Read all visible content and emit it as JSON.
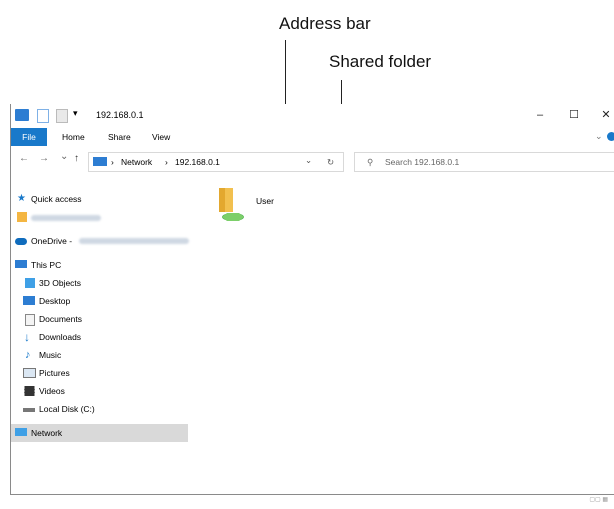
{
  "callouts": {
    "address_bar": "Address bar",
    "shared_folder": "Shared folder"
  },
  "window": {
    "title": "192.168.0.1",
    "minimize": "–",
    "maximize": "☐",
    "close": "✕"
  },
  "ribbon": {
    "tabs": [
      "File",
      "Home",
      "Share",
      "View"
    ]
  },
  "nav": {
    "back": "←",
    "forward": "→",
    "recent": "⌄",
    "up": "↑",
    "breadcrumb": [
      "Network",
      "192.168.0.1"
    ],
    "dropdown": "⌄",
    "refresh": "↻"
  },
  "search": {
    "placeholder": "Search 192.168.0.1"
  },
  "sidebar": {
    "items": [
      {
        "label": "Quick access",
        "icon": "star-icon"
      },
      {
        "label": "",
        "icon": "folder-icon"
      },
      {
        "label": "OneDrive -",
        "icon": "cloud-icon"
      },
      {
        "label": "This PC",
        "icon": "computer-icon"
      },
      {
        "label": "3D Objects",
        "icon": "cube-icon"
      },
      {
        "label": "Desktop",
        "icon": "desktop-icon"
      },
      {
        "label": "Documents",
        "icon": "document-icon"
      },
      {
        "label": "Downloads",
        "icon": "download-icon"
      },
      {
        "label": "Music",
        "icon": "music-icon"
      },
      {
        "label": "Pictures",
        "icon": "picture-icon"
      },
      {
        "label": "Videos",
        "icon": "video-icon"
      },
      {
        "label": "Local Disk (C:)",
        "icon": "drive-icon"
      },
      {
        "label": "Network",
        "icon": "network-icon"
      }
    ]
  },
  "content": {
    "items": [
      {
        "label": "User",
        "icon": "shared-folder-icon"
      }
    ]
  },
  "colors": {
    "accent": "#1979ca",
    "selection": "#d9d9d9"
  }
}
